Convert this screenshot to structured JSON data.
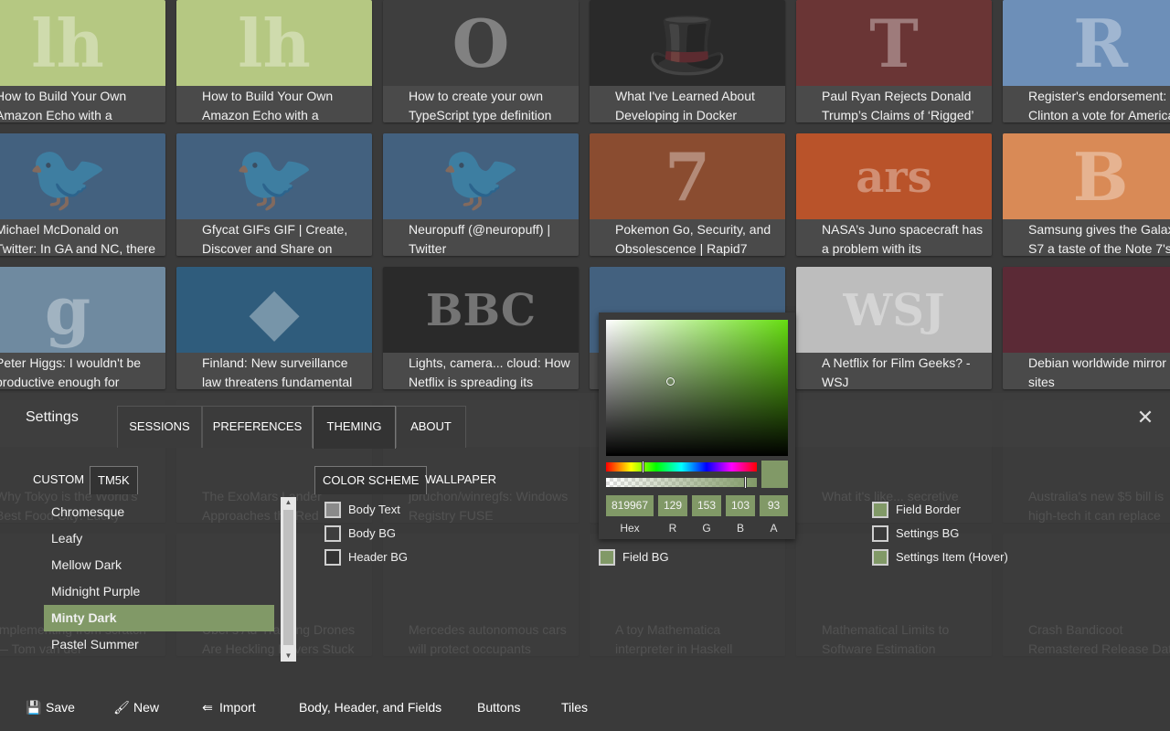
{
  "tiles": [
    {
      "caption": "How to Build Your Own Amazon Echo with a",
      "thumb_glyph": "lh",
      "thumb_bg": "#b5c882",
      "fav": "lh",
      "fav_bg": "#8aa648"
    },
    {
      "caption": "How to Build Your Own Amazon Echo with a",
      "thumb_glyph": "lh",
      "thumb_bg": "#b5c882",
      "fav": "lh",
      "fav_bg": "#8aa648"
    },
    {
      "caption": "How to create your own TypeScript type definition",
      "thumb_glyph": "O",
      "thumb_bg": "#3e3e3e",
      "fav": "o",
      "fav_bg": "#ffffff"
    },
    {
      "caption": "What I've Learned About Developing in Docker",
      "thumb_glyph": "🎩",
      "thumb_bg": "#2a2a2a",
      "fav": "🎩",
      "fav_bg": "#444444"
    },
    {
      "caption": "Paul Ryan Rejects Donald Trump’s Claims of ‘Rigged’",
      "thumb_glyph": "T",
      "thumb_bg": "#6a3535",
      "fav": "T",
      "fav_bg": "#4a4a4a"
    },
    {
      "caption": "Register's endorsement: Clinton a vote for America",
      "thumb_glyph": "R",
      "thumb_bg": "#6d8fb8",
      "fav": "R",
      "fav_bg": "#2f5f9f"
    },
    {
      "caption": "Michael McDonald on Twitter: In GA and NC, there was a",
      "thumb_glyph": "🐦",
      "thumb_bg": "#43617f",
      "fav": "🐦",
      "fav_bg": "#4a4a4a"
    },
    {
      "caption": "Gfycat GIFs GIF | Create, Discover and Share on",
      "thumb_glyph": "🐦",
      "thumb_bg": "#43617f",
      "fav": "🐦",
      "fav_bg": "#4a4a4a"
    },
    {
      "caption": "Neuropuff (@neuropuff) | Twitter",
      "thumb_glyph": "🐦",
      "thumb_bg": "#43617f",
      "fav": "🐦",
      "fav_bg": "#4a4a4a"
    },
    {
      "caption": "Pokemon Go, Security, and Obsolescence | Rapid7",
      "thumb_glyph": "7",
      "thumb_bg": "#8a4c30",
      "fav": "7",
      "fav_bg": "#e06c2a"
    },
    {
      "caption": "NASA’s Juno spacecraft has a problem with its",
      "thumb_glyph": "ars",
      "thumb_bg": "#b9532a",
      "fav": "ars",
      "fav_bg": "#e25c2a"
    },
    {
      "caption": "Samsung gives the Galaxy S7 a taste of the Note 7's",
      "thumb_glyph": "B",
      "thumb_bg": "#d98a56",
      "fav": "B",
      "fav_bg": "#f57d00"
    },
    {
      "caption": "Peter Higgs: I wouldn't be productive enough for",
      "thumb_glyph": "g",
      "thumb_bg": "#6f8aa0",
      "fav": "g",
      "fav_bg": "#4a4a4a"
    },
    {
      "caption": "Finland: New surveillance law threatens fundamental",
      "thumb_glyph": "◆",
      "thumb_bg": "#2f5c7c",
      "fav": "◆",
      "fav_bg": "#1c8ad8"
    },
    {
      "caption": "Lights, camera... cloud: How Netflix is spreading its",
      "thumb_glyph": "BBC",
      "thumb_bg": "#2a2a2a",
      "fav": "bbc",
      "fav_bg": "#4a4a4a"
    },
    {
      "caption": "",
      "thumb_glyph": "",
      "thumb_bg": "#43617f",
      "fav": "",
      "fav_bg": "#4a4a4a"
    },
    {
      "caption": "A Netflix for Film Geeks? - WSJ",
      "thumb_glyph": "WSJ",
      "thumb_bg": "#bdbdbd",
      "fav": "WSJ",
      "fav_bg": "#ffffff"
    },
    {
      "caption": "Debian worldwide mirror sites",
      "thumb_glyph": "",
      "thumb_bg": "#5b2a36",
      "fav": "",
      "fav_bg": "#4a4a4a"
    },
    {
      "caption": "Why Tokyo is the World's Best Food City: Lucky",
      "thumb_glyph": "",
      "thumb_bg": "#4a4a4a",
      "fav": "",
      "fav_bg": "#4a4a4a"
    },
    {
      "caption": "The ExoMars Lander Approaches the Red",
      "thumb_glyph": "",
      "thumb_bg": "#4a4a4a",
      "fav": "",
      "fav_bg": "#4a4a4a"
    },
    {
      "caption": "jbruchon/winregfs: Windows Registry FUSE",
      "thumb_glyph": "",
      "thumb_bg": "#4a4a4a",
      "fav": "",
      "fav_bg": "#4a4a4a"
    },
    {
      "caption": "",
      "thumb_glyph": "",
      "thumb_bg": "#4a4a4a",
      "fav": "",
      "fav_bg": "#4a4a4a"
    },
    {
      "caption": "What it's like... secretive",
      "thumb_glyph": "",
      "thumb_bg": "#4a4a4a",
      "fav": "",
      "fav_bg": "#4a4a4a"
    },
    {
      "caption": "Australia's new $5 bill is high-tech it can replace",
      "thumb_glyph": "",
      "thumb_bg": "#4a4a4a",
      "fav": "",
      "fav_bg": "#4a4a4a"
    },
    {
      "caption": "Implementing from scratch — Tom van der",
      "thumb_glyph": "",
      "thumb_bg": "#4a4a4a",
      "fav": "",
      "fav_bg": "#4a4a4a"
    },
    {
      "caption": "Uber's Ad-Tracking Drones Are Heckling Drivers Stuck",
      "thumb_glyph": "",
      "thumb_bg": "#4a4a4a",
      "fav": "",
      "fav_bg": "#4a4a4a"
    },
    {
      "caption": "Mercedes autonomous cars will protect occupants",
      "thumb_glyph": "",
      "thumb_bg": "#4a4a4a",
      "fav": "",
      "fav_bg": "#4a4a4a"
    },
    {
      "caption": "A toy Mathematica interpreter in Haskell",
      "thumb_glyph": "",
      "thumb_bg": "#4a4a4a",
      "fav": "",
      "fav_bg": "#4a4a4a"
    },
    {
      "caption": "Mathematical Limits to Software Estimation",
      "thumb_glyph": "",
      "thumb_bg": "#4a4a4a",
      "fav": "",
      "fav_bg": "#4a4a4a"
    },
    {
      "caption": "Crash Bandicoot Remastered Release Date",
      "thumb_glyph": "",
      "thumb_bg": "#4a4a4a",
      "fav": "",
      "fav_bg": "#4a4a4a"
    }
  ],
  "settings": {
    "title": "Settings",
    "tabs": [
      "SESSIONS",
      "PREFERENCES",
      "THEMING",
      "ABOUT"
    ],
    "active_tab": "THEMING",
    "close_icon": "close-icon",
    "theme_tabs": [
      "CUSTOM",
      "TM5K"
    ],
    "active_theme_tab": "TM5K",
    "scheme_tabs": [
      "COLOR SCHEME",
      "WALLPAPER"
    ],
    "active_scheme_tab": "COLOR SCHEME",
    "themes": [
      "Chromesque",
      "Leafy",
      "Mellow Dark",
      "Midnight Purple",
      "Minty Dark",
      "Pastel Summer"
    ],
    "selected_theme": "Minty Dark",
    "swatches_left": [
      {
        "label": "Body Text",
        "color": "#8a8a8a"
      },
      {
        "label": "Body BG",
        "color": "#3e3e3e"
      },
      {
        "label": "Header BG",
        "color": "#333333"
      }
    ],
    "swatch_field_bg": {
      "label": "Field BG",
      "color": "#819967"
    },
    "swatches_right": [
      {
        "label": "Field Border",
        "color": "#819967"
      },
      {
        "label": "Settings BG",
        "color": "#3a3a3a"
      },
      {
        "label": "Settings Item (Hover)",
        "color": "#819967"
      }
    ]
  },
  "picker": {
    "hex": "819967",
    "r": "129",
    "g": "153",
    "b": "103",
    "a": "93",
    "labels": {
      "hex": "Hex",
      "r": "R",
      "g": "G",
      "b": "B",
      "a": "A"
    },
    "color": "#819967"
  },
  "toolbar": {
    "save": "Save",
    "new": "New",
    "import": "Import",
    "body_header_fields": "Body, Header, and Fields",
    "buttons": "Buttons",
    "tiles": "Tiles"
  }
}
